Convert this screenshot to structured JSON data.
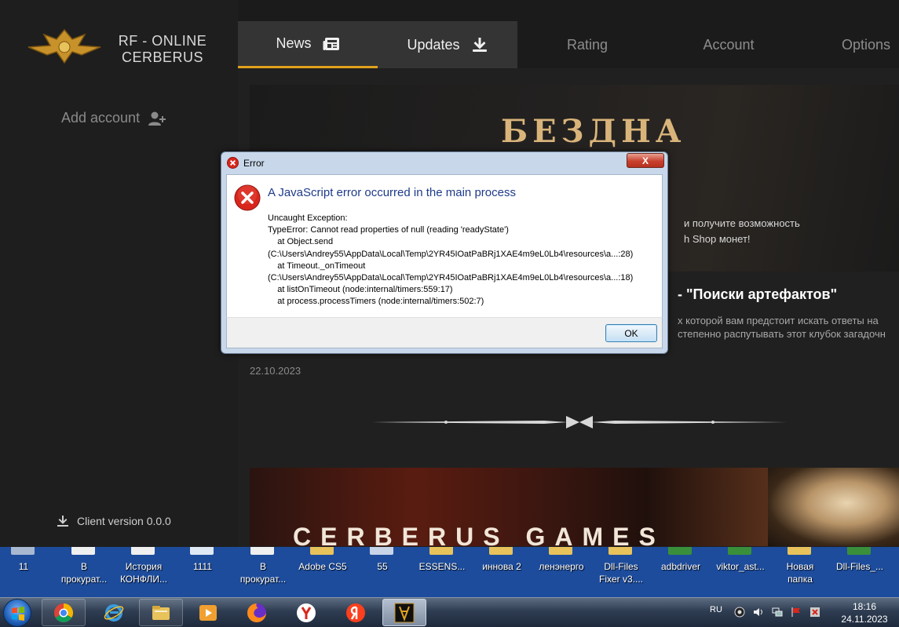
{
  "app": {
    "logo_text_line1": "RF - ONLINE",
    "logo_text_line2": "CERBERUS",
    "add_account": "Add account",
    "client_version": "Client version 0.0.0",
    "accent_color": "#e0a21e"
  },
  "nav": {
    "tabs": [
      {
        "label": "News",
        "icon": "newspaper-icon",
        "active": true
      },
      {
        "label": "Updates",
        "icon": "download-icon"
      },
      {
        "label": "Rating"
      },
      {
        "label": "Account"
      },
      {
        "label": "Options"
      }
    ]
  },
  "news": {
    "banner_title": "БЕЗДНА",
    "banner_line1": "и получите возможность",
    "banner_line2": "h Shop монет!",
    "title": "- \"Поиски артефактов\"",
    "text_line1": "х которой вам предстоит искать ответы на",
    "text_line2": "степенно распутывать этот клубок загадочн",
    "date": "22.10.2023",
    "banner2_text": "CERBERUS GAMES"
  },
  "dialog": {
    "title": "Error",
    "close_label": "X",
    "heading": "A JavaScript error occurred in the main process",
    "message_lines": [
      "Uncaught Exception:",
      "TypeError: Cannot read properties of null (reading 'readyState')",
      "    at Object.send",
      "(C:\\Users\\Andrey55\\AppData\\Local\\Temp\\2YR45IOatPaBRj1XAE4m9eL0Lb4\\resources\\a...:28)",
      "    at Timeout._onTimeout",
      "(C:\\Users\\Andrey55\\AppData\\Local\\Temp\\2YR45IOatPaBRj1XAE4m9eL0Lb4\\resources\\a...:18)",
      "    at listOnTimeout (node:internal/timers:559:17)",
      "    at process.processTimers (node:internal/timers:502:7)"
    ],
    "ok_label": "OK"
  },
  "desktop": {
    "icons": [
      {
        "line1": "11",
        "line2": "",
        "color": "#a8b8d0"
      },
      {
        "line1": "В",
        "line2": "прокурат...",
        "color": "#f0f0f0"
      },
      {
        "line1": "История",
        "line2": "КОНФЛИ...",
        "color": "#f0f0f0"
      },
      {
        "line1": "1111",
        "line2": "",
        "color": "#dfe8f5"
      },
      {
        "line1": "В",
        "line2": "прокурат...",
        "color": "#f0f0f0"
      },
      {
        "line1": "Adobe CS5",
        "line2": "",
        "color": "#e8c25a"
      },
      {
        "line1": "55",
        "line2": "",
        "color": "#c8d4e8"
      },
      {
        "line1": "ESSENS...",
        "line2": "",
        "color": "#e8c25a"
      },
      {
        "line1": "иннова 2",
        "line2": "",
        "color": "#e8c25a"
      },
      {
        "line1": "ленэнерго",
        "line2": "",
        "color": "#e8c25a"
      },
      {
        "line1": "Dll-Files",
        "line2": "Fixer v3....",
        "color": "#e8c25a"
      },
      {
        "line1": "adbdriver",
        "line2": "",
        "color": "#3a8f3a"
      },
      {
        "line1": "viktor_ast...",
        "line2": "",
        "color": "#3a8f3a"
      },
      {
        "line1": "Новая",
        "line2": "папка",
        "color": "#e8c25a"
      },
      {
        "line1": "Dll-Files_...",
        "line2": "",
        "color": "#3a8f3a"
      }
    ]
  },
  "taskbar": {
    "items": [
      {
        "name": "chrome-icon",
        "state": "pinned"
      },
      {
        "name": "internet-explorer-icon",
        "state": "none"
      },
      {
        "name": "file-explorer-icon",
        "state": "pinned"
      },
      {
        "name": "media-player-icon",
        "state": "none"
      },
      {
        "name": "firefox-icon",
        "state": "none"
      },
      {
        "name": "yandex-browser-icon",
        "state": "none"
      },
      {
        "name": "yandex-icon",
        "state": "none"
      },
      {
        "name": "rf-online-launcher-icon",
        "state": "active"
      }
    ],
    "tray_lang": "RU",
    "clock_time": "18:16",
    "clock_date": "24.11.2023"
  }
}
